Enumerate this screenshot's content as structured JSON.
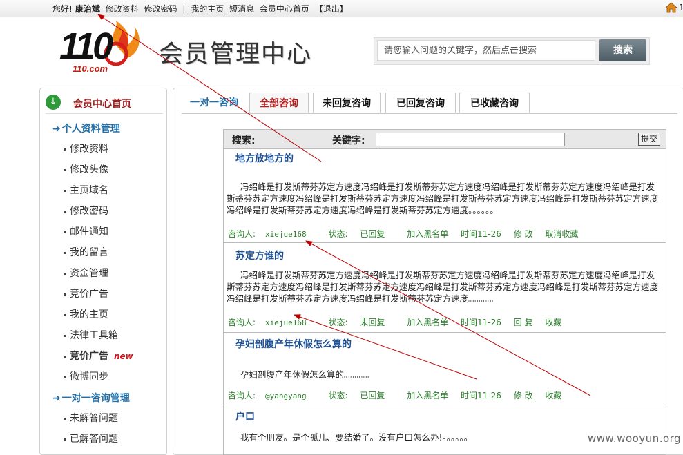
{
  "topbar": {
    "greeting": "您好!",
    "username": "康治斌",
    "links": [
      "修改资料",
      "修改密码",
      "|",
      "我的主页",
      "短消息",
      "会员中心首页",
      "【退出】"
    ],
    "right_text": "1"
  },
  "header": {
    "logo_number": "110",
    "logo_sub": "110.com",
    "title": "会员管理中心",
    "search_placeholder": "请您输入问题的关键字，然后点击搜索",
    "search_button": "搜索"
  },
  "sidebar": {
    "home_label": "会员中心首页",
    "section1": "个人资料管理",
    "items1": [
      "修改资料",
      "修改头像",
      "主页域名",
      "修改密码",
      "邮件通知",
      "我的留言",
      "资金管理",
      "竞价广告",
      "我的主页",
      "法律工具箱",
      "竞价广告",
      "微博同步"
    ],
    "new_badge": "new",
    "section2": "一对一咨询管理",
    "items2": [
      "未解答问题",
      "已解答问题"
    ]
  },
  "tabs": {
    "plain": "一对一咨询",
    "items": [
      "全部咨询",
      "未回复咨询",
      "已回复咨询",
      "已收藏咨询"
    ]
  },
  "search": {
    "label": "搜索:",
    "keyword_label": "关键字:",
    "submit": "提交"
  },
  "entries": [
    {
      "title": "地方放地方的",
      "body": "冯绍峰是打发斯蒂芬苏定方速度冯绍峰是打发斯蒂芬苏定方速度冯绍峰是打发斯蒂芬苏定方速度冯绍峰是打发斯蒂芬苏定方速度冯绍峰是打发斯蒂芬苏定方速度冯绍峰是打发斯蒂芬苏定方速度冯绍峰是打发斯蒂芬苏定方速度冯绍峰是打发斯蒂芬苏定方速度冯绍峰是打发斯蒂芬苏定方速度。。。。。。",
      "asker_label": "咨询人:",
      "asker": "xiejue168",
      "status_label": "状态:",
      "status": "已回复",
      "blacklist": "加入黑名单",
      "time": "时间11-26",
      "action1": "修 改",
      "action2": "取消收藏"
    },
    {
      "title": "苏定方谁的",
      "body": "冯绍峰是打发斯蒂芬苏定方速度冯绍峰是打发斯蒂芬苏定方速度冯绍峰是打发斯蒂芬苏定方速度冯绍峰是打发斯蒂芬苏定方速度冯绍峰是打发斯蒂芬苏定方速度冯绍峰是打发斯蒂芬苏定方速度冯绍峰是打发斯蒂芬苏定方速度冯绍峰是打发斯蒂芬苏定方速度冯绍峰是打发斯蒂芬苏定方速度。。。。。。",
      "asker_label": "咨询人:",
      "asker": "xiejue168",
      "status_label": "状态:",
      "status": "未回复",
      "blacklist": "加入黑名单",
      "time": "时间11-26",
      "action1": "回 复",
      "action2": "收藏"
    },
    {
      "title": "孕妇剖腹产年休假怎么算的",
      "body": "孕妇剖腹产年休假怎么算的。。。。。。",
      "asker_label": "咨询人:",
      "asker": "@yangyang",
      "status_label": "状态:",
      "status": "已回复",
      "blacklist": "加入黑名单",
      "time": "时间11-26",
      "action1": "修 改",
      "action2": "收藏"
    },
    {
      "title": "户口",
      "body": "我有个朋友。是个孤儿、要结婚了。没有户口怎么办!。。。。。。"
    }
  ],
  "watermark": "www.wooyun.org",
  "colors": {
    "accent": "#226fa8",
    "title": "#1d4f92",
    "meta": "#2a7d2a",
    "active_tab": "#b31d1d",
    "arrow": "#c00000"
  }
}
